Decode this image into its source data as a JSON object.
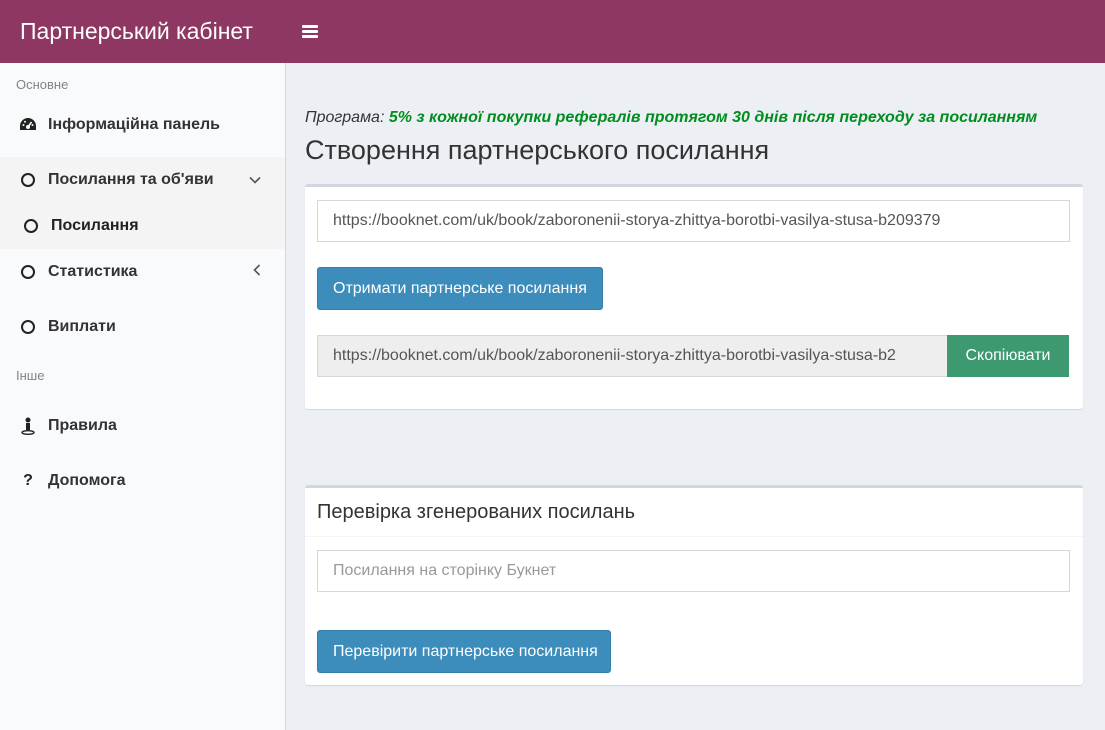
{
  "header": {
    "brand": "Партнерський кабінет"
  },
  "sidebar": {
    "section_main": "Основне",
    "section_other": "Інше",
    "items": {
      "dashboard": "Інформаційна панель",
      "links_ads": "Посилання та об'яви",
      "links": "Посилання",
      "statistics": "Статистика",
      "payouts": "Виплати",
      "rules": "Правила",
      "help": "Допомога"
    }
  },
  "main": {
    "program_label": "Програма:",
    "program_value": "5% з кожної покупки рефералів протягом 30 днів після переходу за посиланням",
    "title": "Створення партнерського посилання",
    "create": {
      "source_url_value": "https://booknet.com/uk/book/zaboronenii-storya-zhittya-borotbi-vasilya-stusa-b209379",
      "get_button": "Отримати партнерське посилання",
      "generated_value": "https://booknet.com/uk/book/zaboronenii-storya-zhittya-borotbi-vasilya-stusa-b2",
      "copy_button": "Скопіювати"
    },
    "check": {
      "title": "Перевірка згенерованих посилань",
      "input_placeholder": "Посилання на сторінку Букнет",
      "check_button": "Перевірити партнерське посилання"
    }
  },
  "colors": {
    "topbar": "#8e3762",
    "primary": "#3c8dbc",
    "success": "#3d9970",
    "program_highlight": "#008d1e"
  }
}
